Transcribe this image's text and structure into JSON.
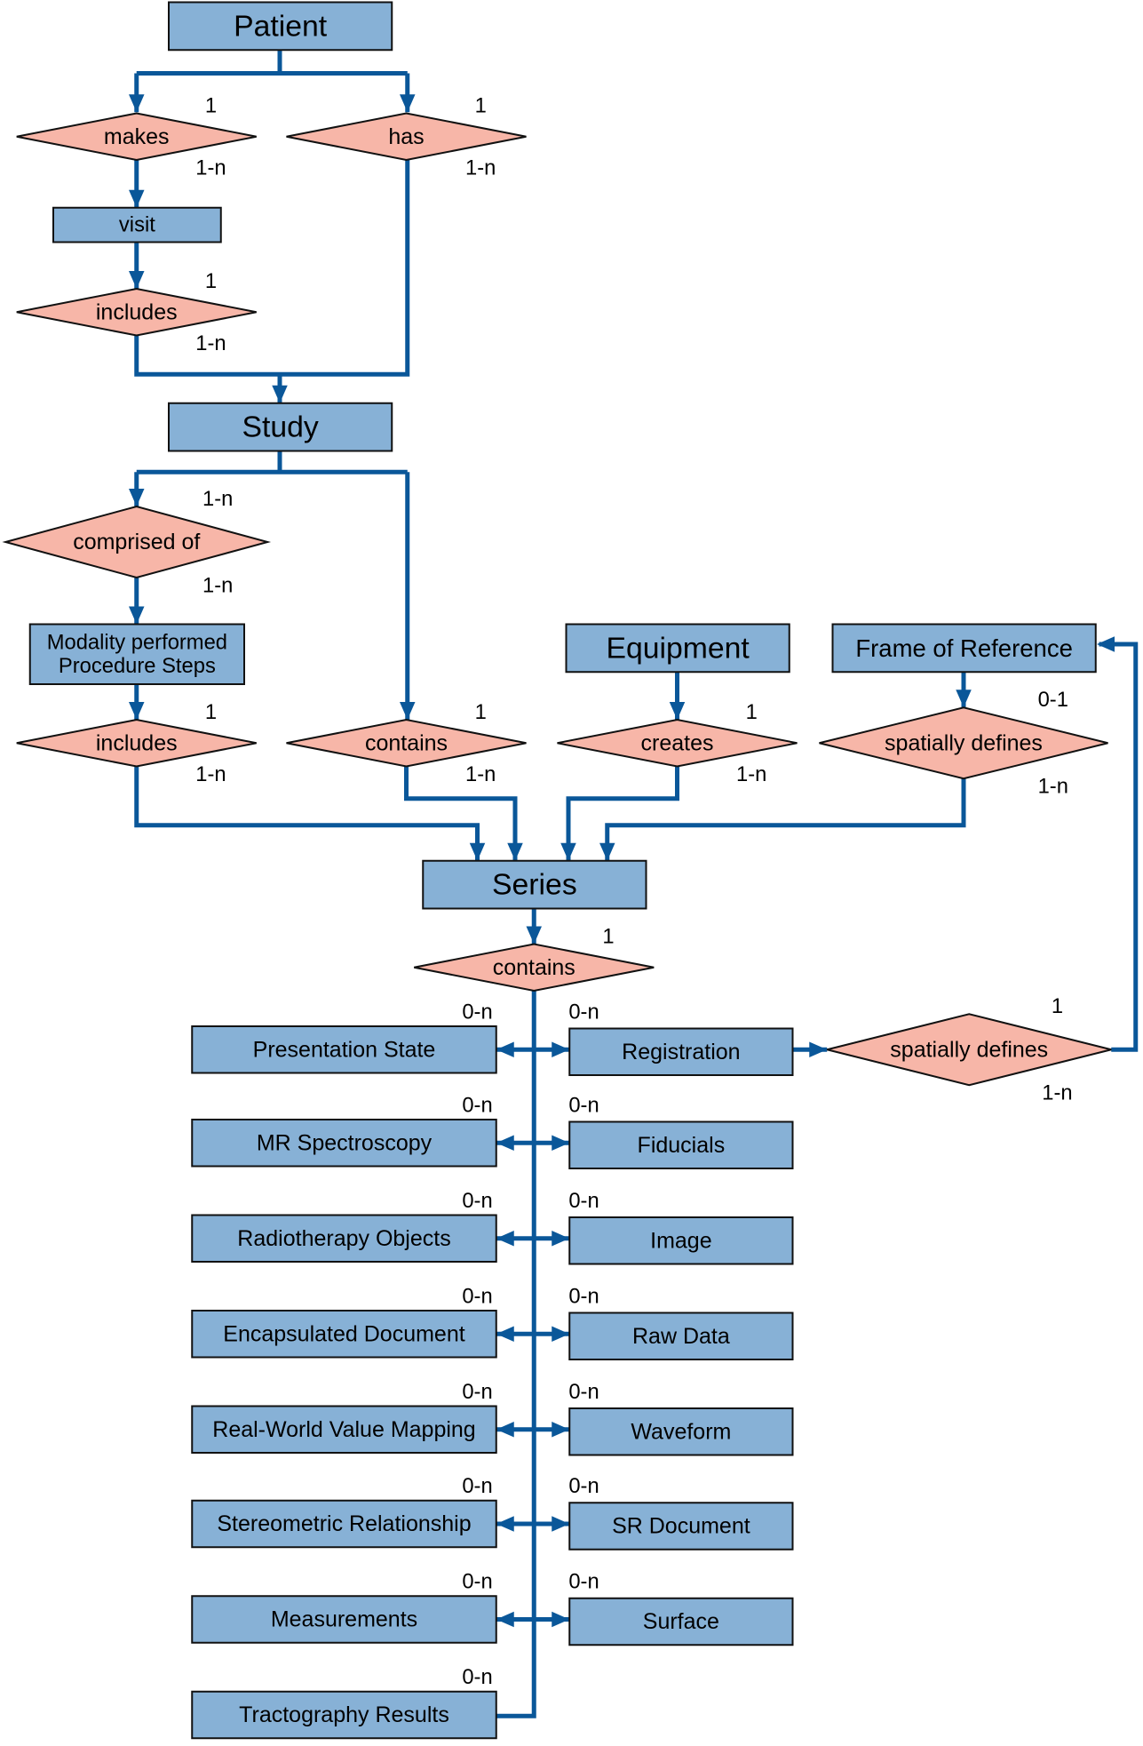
{
  "colors": {
    "entity_fill": "#87b1d6",
    "relationship_fill": "#f7b6a8",
    "connector": "#0a5799"
  },
  "entities": {
    "patient": "Patient",
    "visit": "visit",
    "study": "Study",
    "mpps": [
      "Modality performed",
      "Procedure Steps"
    ],
    "equipment": "Equipment",
    "frame_of_reference": "Frame of Reference",
    "series": "Series",
    "presentation_state": "Presentation State",
    "registration": "Registration",
    "mr_spectroscopy": "MR Spectroscopy",
    "fiducials": "Fiducials",
    "radiotherapy_objects": "Radiotherapy Objects",
    "image": "Image",
    "encapsulated_document": "Encapsulated Document",
    "raw_data": "Raw Data",
    "real_world_value_mapping": "Real-World Value Mapping",
    "waveform": "Waveform",
    "stereometric_relationship": "Stereometric Relationship",
    "sr_document": "SR Document",
    "measurements": "Measurements",
    "surface": "Surface",
    "tractography_results": "Tractography Results"
  },
  "relationships": {
    "makes": {
      "label": "makes",
      "top": "1",
      "bottom": "1-n"
    },
    "has": {
      "label": "has",
      "top": "1",
      "bottom": "1-n"
    },
    "visit_includes": {
      "label": "includes",
      "top": "1",
      "bottom": "1-n"
    },
    "comprised_of": {
      "label": "comprised of",
      "top": "1-n",
      "bottom": "1-n"
    },
    "mpps_includes": {
      "label": "includes",
      "top": "1",
      "bottom": "1-n"
    },
    "study_contains": {
      "label": "contains",
      "top": "1",
      "bottom": "1-n"
    },
    "creates": {
      "label": "creates",
      "top": "1",
      "bottom": "1-n"
    },
    "for_spatially_defines": {
      "label": "spatially defines",
      "top": "0-1",
      "bottom": "1-n"
    },
    "series_contains": {
      "label": "contains",
      "top": "1"
    },
    "reg_spatially_defines": {
      "label": "spatially defines",
      "top": "1",
      "bottom": "1-n"
    }
  },
  "cardinality_0n": "0-n"
}
